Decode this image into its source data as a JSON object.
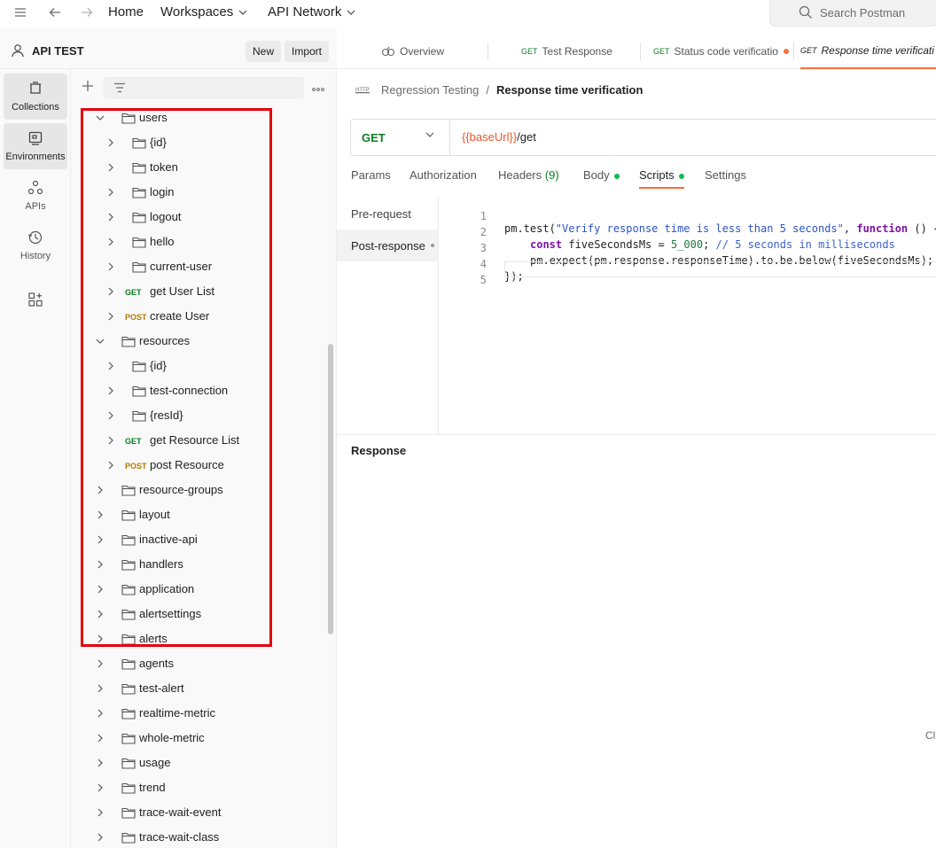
{
  "topbar": {
    "home": "Home",
    "workspaces": "Workspaces",
    "api_network": "API Network",
    "search_placeholder": "Search Postman"
  },
  "workspace": {
    "name": "API TEST",
    "new_label": "New",
    "import_label": "Import"
  },
  "rail": [
    {
      "label": "Collections",
      "icon": "collections-icon"
    },
    {
      "label": "Environments",
      "icon": "environments-icon"
    },
    {
      "label": "APIs",
      "icon": "apis-icon"
    },
    {
      "label": "History",
      "icon": "history-icon"
    }
  ],
  "tree": [
    {
      "label": "users",
      "expanded": true
    },
    {
      "label": "{id}"
    },
    {
      "label": "token"
    },
    {
      "label": "login"
    },
    {
      "label": "logout"
    },
    {
      "label": "hello"
    },
    {
      "label": "current-user"
    },
    {
      "label": "get User List",
      "method": "GET"
    },
    {
      "label": "create User",
      "method": "POST"
    },
    {
      "label": "resources",
      "expanded": true
    },
    {
      "label": "{id}"
    },
    {
      "label": "test-connection"
    },
    {
      "label": "{resId}"
    },
    {
      "label": "get Resource List",
      "method": "GET"
    },
    {
      "label": "post Resource",
      "method": "POST"
    },
    {
      "label": "resource-groups"
    },
    {
      "label": "layout"
    },
    {
      "label": "inactive-api"
    },
    {
      "label": "handlers"
    },
    {
      "label": "application"
    },
    {
      "label": "alertsettings"
    },
    {
      "label": "alerts"
    },
    {
      "label": "agents"
    },
    {
      "label": "test-alert"
    },
    {
      "label": "realtime-metric"
    },
    {
      "label": "whole-metric"
    },
    {
      "label": "usage"
    },
    {
      "label": "trend"
    },
    {
      "label": "trace-wait-event"
    },
    {
      "label": "trace-wait-class"
    }
  ],
  "tabs": [
    {
      "method": "",
      "label": "Overview"
    },
    {
      "method": "GET",
      "label": "Test Response"
    },
    {
      "method": "GET",
      "label": "Status code verificatio"
    },
    {
      "method": "GET",
      "label": "Response time verificati"
    }
  ],
  "breadcrumb": {
    "parent": "Regression Testing",
    "separator": "/",
    "current": "Response time verification"
  },
  "request": {
    "method": "GET",
    "url_var": "{{baseUrl}}",
    "url_path": "/get"
  },
  "subtabs": {
    "params": "Params",
    "authorization": "Authorization",
    "headers": "Headers",
    "headers_count": "(9)",
    "body": "Body",
    "scripts": "Scripts",
    "settings": "Settings"
  },
  "scripts": {
    "pre_request": "Pre-request",
    "post_response": "Post-response"
  },
  "code": {
    "line_numbers": [
      "1",
      "2",
      "3",
      "4",
      "5"
    ],
    "l1_a": "pm.test(",
    "l1_str": "\"Verify response time is less than 5 seconds\"",
    "l1_b": ", ",
    "l1_kw": "function",
    "l1_c": " () {",
    "l2_kw": "const",
    "l2_a": " fiveSecondsMs = ",
    "l2_num": "5_000",
    "l2_b": "; ",
    "l2_cmt": "// 5 seconds in milliseconds",
    "l3": "pm.expect(pm.response.responseTime).to.be.below(fiveSecondsMs);",
    "l4": "});"
  },
  "response": {
    "title": "Response",
    "clipped_text": "Cl"
  },
  "colors": {
    "accent": "#ff6c37",
    "get": "#0c7c25",
    "post": "#ad7a03",
    "highlight": "#e3000b"
  }
}
